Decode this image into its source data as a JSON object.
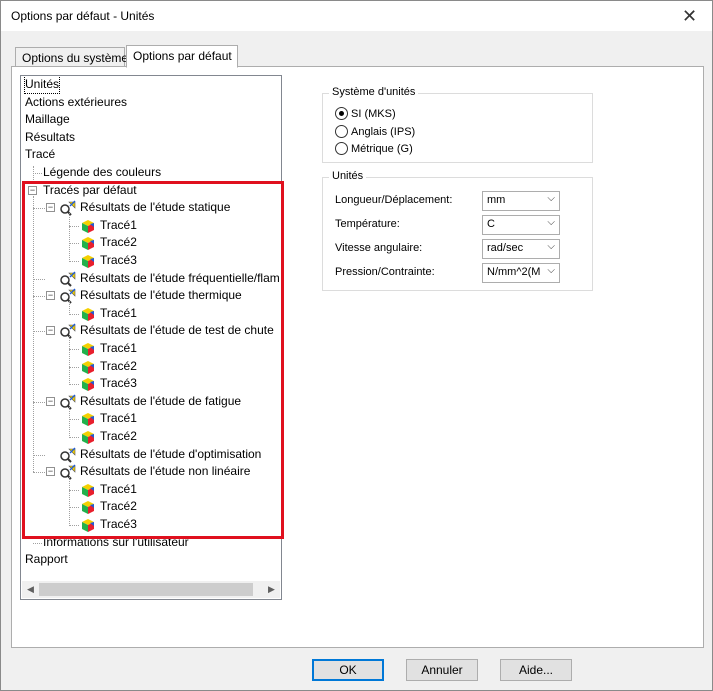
{
  "window": {
    "title": "Options par défaut - Unités"
  },
  "tabs": [
    {
      "label": "Options du système"
    },
    {
      "label": "Options par défaut"
    }
  ],
  "tree": {
    "top_items": [
      "Unités",
      "Actions extérieures",
      "Maillage",
      "Résultats",
      "Tracé"
    ],
    "legend": "Légende des couleurs",
    "default_plots": "Tracés par défaut",
    "studies": [
      {
        "label": "Résultats de l'étude statique",
        "icon": "static-study-icon",
        "plots": [
          "Tracé1",
          "Tracé2",
          "Tracé3"
        ]
      },
      {
        "label": "Résultats de l'étude fréquentielle/flam",
        "icon": "frequency-study-icon",
        "plots": []
      },
      {
        "label": "Résultats de l'étude thermique",
        "icon": "thermal-study-icon",
        "plots": [
          "Tracé1"
        ]
      },
      {
        "label": "Résultats de l'étude de test de chute",
        "icon": "drop-test-study-icon",
        "plots": [
          "Tracé1",
          "Tracé2",
          "Tracé3"
        ]
      },
      {
        "label": "Résultats de l'étude de fatigue",
        "icon": "fatigue-study-icon",
        "plots": [
          "Tracé1",
          "Tracé2"
        ]
      },
      {
        "label": "Résultats de l'étude d'optimisation",
        "icon": "optimization-study-icon",
        "plots": []
      },
      {
        "label": "Résultats de l'étude non linéaire",
        "icon": "nonlinear-study-icon",
        "plots": [
          "Tracé1",
          "Tracé2",
          "Tracé3"
        ]
      }
    ],
    "user_info": "Informations sur l'utilisateur",
    "report": "Rapport"
  },
  "unit_system": {
    "title": "Système d'unités",
    "options": [
      {
        "label": "SI (MKS)",
        "checked": true
      },
      {
        "label": "Anglais (IPS)",
        "checked": false
      },
      {
        "label": "Métrique (G)",
        "checked": false
      }
    ]
  },
  "units": {
    "title": "Unités",
    "fields": [
      {
        "label": "Longueur/Déplacement:",
        "value": "mm"
      },
      {
        "label": "Température:",
        "value": "C"
      },
      {
        "label": "Vitesse angulaire:",
        "value": "rad/sec"
      },
      {
        "label": "Pression/Contrainte:",
        "value": "N/mm^2(M"
      }
    ]
  },
  "buttons": {
    "ok": "OK",
    "cancel": "Annuler",
    "help": "Aide..."
  },
  "colors": {
    "highlight": "#e0101e",
    "default_button": "#0078d7"
  }
}
